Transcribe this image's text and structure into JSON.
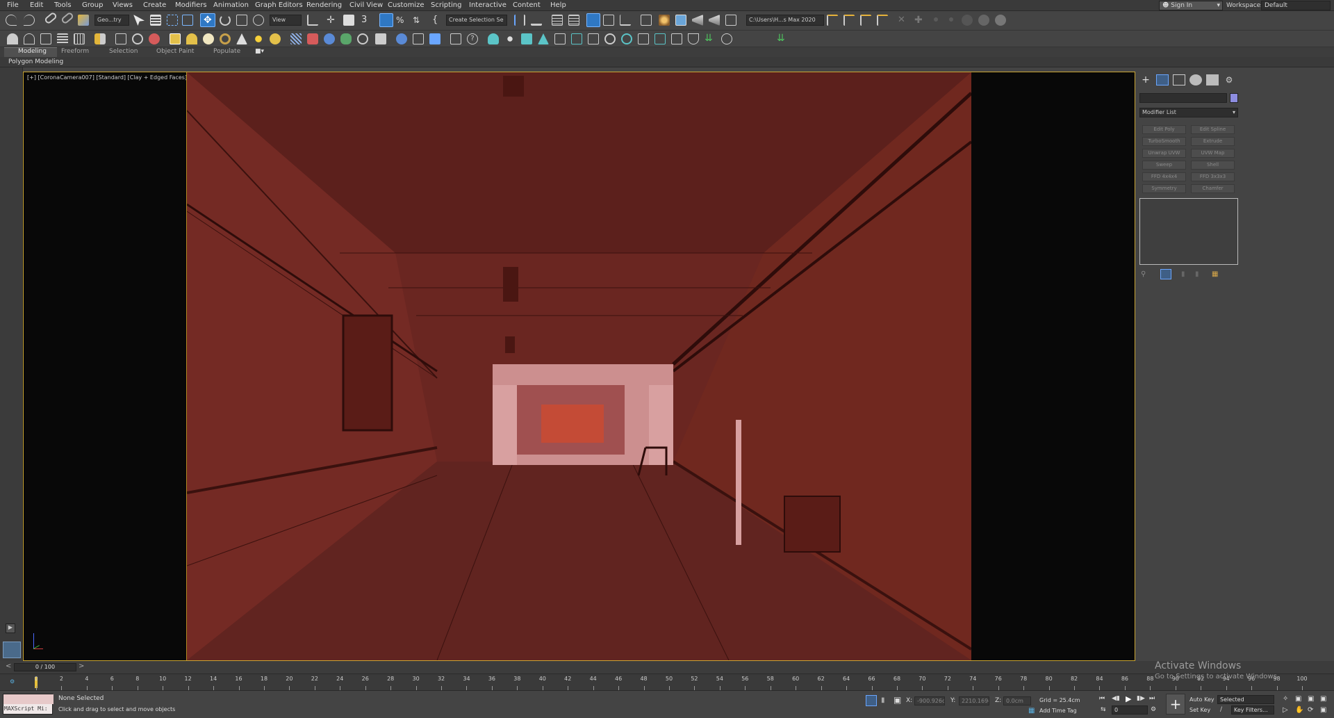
{
  "menubar": {
    "items": [
      "File",
      "Edit",
      "Tools",
      "Group",
      "Views",
      "Create",
      "Modifiers",
      "Animation",
      "Graph Editors",
      "Rendering",
      "Civil View",
      "Customize",
      "Scripting",
      "Interactive",
      "Content",
      "Help"
    ],
    "sign_in": "Sign In",
    "workspaces_label": "Workspaces:",
    "workspace_value": "Default"
  },
  "toolbar": {
    "selection_filter": "Geo...try",
    "ref_coord": "View",
    "named_selection": "Create Selection Se",
    "project_path": "C:\\Users\\H...s Max 2020"
  },
  "ribbon": {
    "tabs": [
      "Modeling",
      "Freeform",
      "Selection",
      "Object Paint",
      "Populate"
    ],
    "subpanel": "Polygon Modeling"
  },
  "viewport": {
    "label": "[+] [CoronaCamera007] [Standard] [Clay + Edged Faces]",
    "colors": {
      "clay": "#6a2621",
      "border": "#cba633"
    }
  },
  "command_panel": {
    "modifier_list": "Modifier List",
    "modifier_buttons": [
      "Edit Poly",
      "Edit Spline",
      "TurboSmooth",
      "Extrude",
      "Unwrap UVW",
      "UVW Map",
      "Sweep",
      "Shell",
      "FFD 4x4x4",
      "FFD 3x3x3",
      "Symmetry",
      "Chamfer"
    ]
  },
  "time_slider": {
    "frame": "0 / 100"
  },
  "track_bar": {
    "ticks": [
      "0",
      "2",
      "4",
      "6",
      "8",
      "10",
      "12",
      "14",
      "16",
      "18",
      "20",
      "22",
      "24",
      "26",
      "28",
      "30",
      "32",
      "34",
      "36",
      "38",
      "40",
      "42",
      "44",
      "46",
      "48",
      "50",
      "52",
      "54",
      "56",
      "58",
      "60",
      "62",
      "64",
      "66",
      "68",
      "70",
      "72",
      "74",
      "76",
      "78",
      "80",
      "82",
      "84",
      "86",
      "88",
      "90",
      "92",
      "94",
      "96",
      "98",
      "100"
    ]
  },
  "status": {
    "maxscript": "MAXScript Mi:",
    "selection": "None Selected",
    "prompt": "Click and drag to select and move objects",
    "x_label": "X:",
    "x_value": "-900.926cm",
    "y_label": "Y:",
    "y_value": "2210.169cm",
    "z_label": "Z:",
    "z_value": "0.0cm",
    "grid": "Grid = 25.4cm",
    "add_time_tag": "Add Time Tag",
    "auto_key": "Auto Key",
    "set_key": "Set Key",
    "key_mode": "Selected",
    "key_filters": "Key Filters...",
    "current_frame": "0"
  },
  "watermark": {
    "title": "Activate Windows",
    "subtitle": "Go to Settings to activate Windows."
  }
}
